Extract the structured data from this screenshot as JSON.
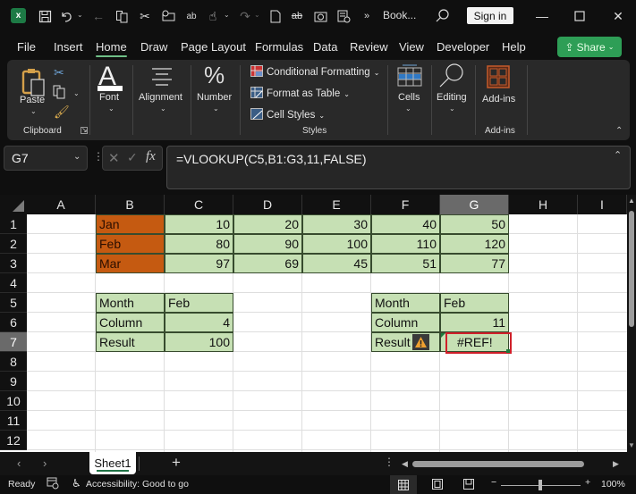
{
  "titlebar": {
    "app_icon": "excel-icon",
    "doc_title": "Book...",
    "sign_in": "Sign in",
    "more": "»",
    "quick_access": [
      "save-icon",
      "undo-icon",
      "back-icon",
      "copy-icon",
      "cut-icon",
      "attach-icon",
      "spelling-icon",
      "touch-icon",
      "redo-icon",
      "new-icon",
      "strikethrough-icon",
      "camera-icon",
      "form-icon"
    ]
  },
  "tabs": [
    "File",
    "Insert",
    "Home",
    "Draw",
    "Page Layout",
    "Formulas",
    "Data",
    "Review",
    "View",
    "Developer",
    "Help"
  ],
  "active_tab": "Home",
  "share_label": "Share",
  "ribbon": {
    "paste": "Paste",
    "clipboard": "Clipboard",
    "font": "Font",
    "alignment": "Alignment",
    "number": "Number",
    "conditional_formatting": "Conditional Formatting",
    "format_as_table": "Format as Table",
    "cell_styles": "Cell Styles",
    "styles": "Styles",
    "cells": "Cells",
    "editing": "Editing",
    "addins": "Add-ins",
    "addins_group": "Add-ins"
  },
  "formula_bar": {
    "name_box": "G7",
    "fx": "fx",
    "formula": "=VLOOKUP(C5,B1:G3,11,FALSE)"
  },
  "columns": [
    "A",
    "B",
    "C",
    "D",
    "E",
    "F",
    "G",
    "H",
    "I"
  ],
  "selected_column": "G",
  "rows": [
    "1",
    "2",
    "3",
    "4",
    "5",
    "6",
    "7",
    "8",
    "9",
    "10",
    "11",
    "12"
  ],
  "selected_row": "7",
  "table": {
    "months": [
      "Jan",
      "Feb",
      "Mar"
    ],
    "values": [
      [
        "10",
        "20",
        "30",
        "40",
        "50"
      ],
      [
        "80",
        "90",
        "100",
        "110",
        "120"
      ],
      [
        "97",
        "69",
        "45",
        "51",
        "77"
      ]
    ]
  },
  "lookup_left": {
    "labels": [
      "Month",
      "Column",
      "Result"
    ],
    "month": "Feb",
    "column": "4",
    "result": "100"
  },
  "lookup_right": {
    "labels": [
      "Month",
      "Column",
      "Result"
    ],
    "month": "Feb",
    "column": "11",
    "result": "#REF!"
  },
  "sheet_tabs": [
    "Sheet1"
  ],
  "add_sheet": "+",
  "status": {
    "ready": "Ready",
    "accessibility": "Accessibility: Good to go",
    "zoom": "100%"
  },
  "colors": {
    "accent_green": "#2e9e56",
    "header_fill": "#c55a11",
    "data_fill": "#c6e0b4",
    "error_outline": "#d0202a"
  }
}
